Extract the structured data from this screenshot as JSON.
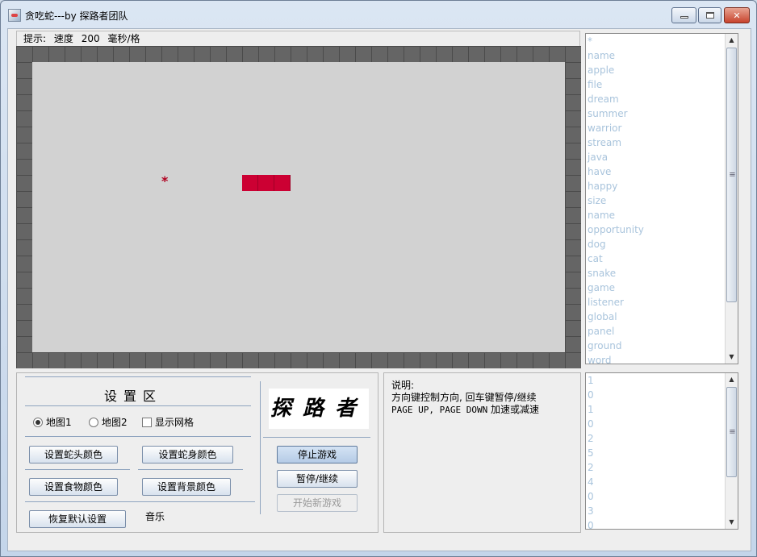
{
  "window": {
    "title": "贪吃蛇---by 探路者团队",
    "controls": {
      "minimize": "",
      "maximize": "",
      "close": "✕"
    }
  },
  "hint": {
    "prefix": "提示:",
    "speed_label": "速度",
    "speed_value": "200",
    "unit": "毫秒/格"
  },
  "board": {
    "food_symbol": "*",
    "snake_color": "#cc0033",
    "wall_color": "#656565",
    "ground_color": "#d2d2d2"
  },
  "settings": {
    "title": "设置区",
    "map1": "地图1",
    "map2": "地图2",
    "selected_map": "地图1",
    "show_grid": "显示网格",
    "show_grid_checked": false,
    "snake_head_color": "设置蛇头颜色",
    "snake_body_color": "设置蛇身颜色",
    "food_color": "设置食物颜色",
    "background_color": "设置背景颜色",
    "restore_defaults": "恢复默认设置",
    "music": "音乐"
  },
  "logo": {
    "text": "探路者"
  },
  "game_controls": {
    "stop": "停止游戏",
    "pause": "暂停/继续",
    "new_game": "开始新游戏"
  },
  "info": {
    "heading": "说明:",
    "line1": "方向键控制方向, 回车键暂停/继续",
    "line2_keys": "PAGE UP, PAGE DOWN",
    "line2_rest": "加速或减速"
  },
  "word_list": [
    "*",
    "name",
    "apple",
    "file",
    "dream",
    "summer",
    "warrior",
    "stream",
    "java",
    "have",
    "happy",
    "size",
    "name",
    "opportunity",
    "dog",
    "cat",
    "snake",
    "game",
    "listener",
    "global",
    "panel",
    "ground",
    "word"
  ],
  "number_list": [
    "1",
    "0",
    "1",
    "0",
    "2",
    "5",
    "2",
    "4",
    "0",
    "3",
    "0"
  ]
}
